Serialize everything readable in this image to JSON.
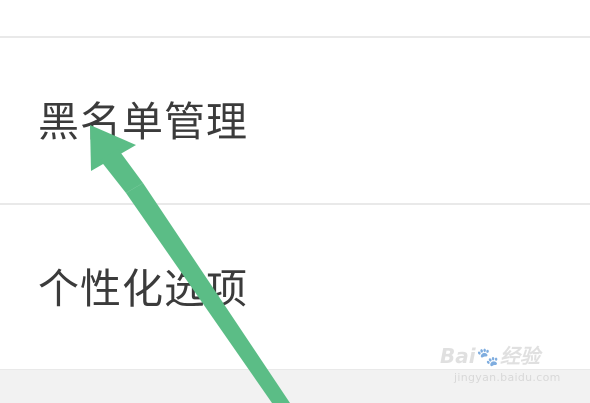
{
  "menu": {
    "items": [
      {
        "label": "黑名单管理"
      },
      {
        "label": "个性化选项"
      }
    ]
  },
  "watermark": {
    "logo": "Bai",
    "logo_suffix": "经验",
    "url": "jingyan.baidu.com"
  },
  "colors": {
    "background": "#ffffff",
    "divider": "#e9e9e9",
    "text": "#3b3b3b",
    "arrow": "#5bbd86",
    "bottom_band": "#f2f2f2"
  },
  "icons": {
    "annotation": "arrow-annotation-icon",
    "watermark_paw": "paw-icon"
  }
}
